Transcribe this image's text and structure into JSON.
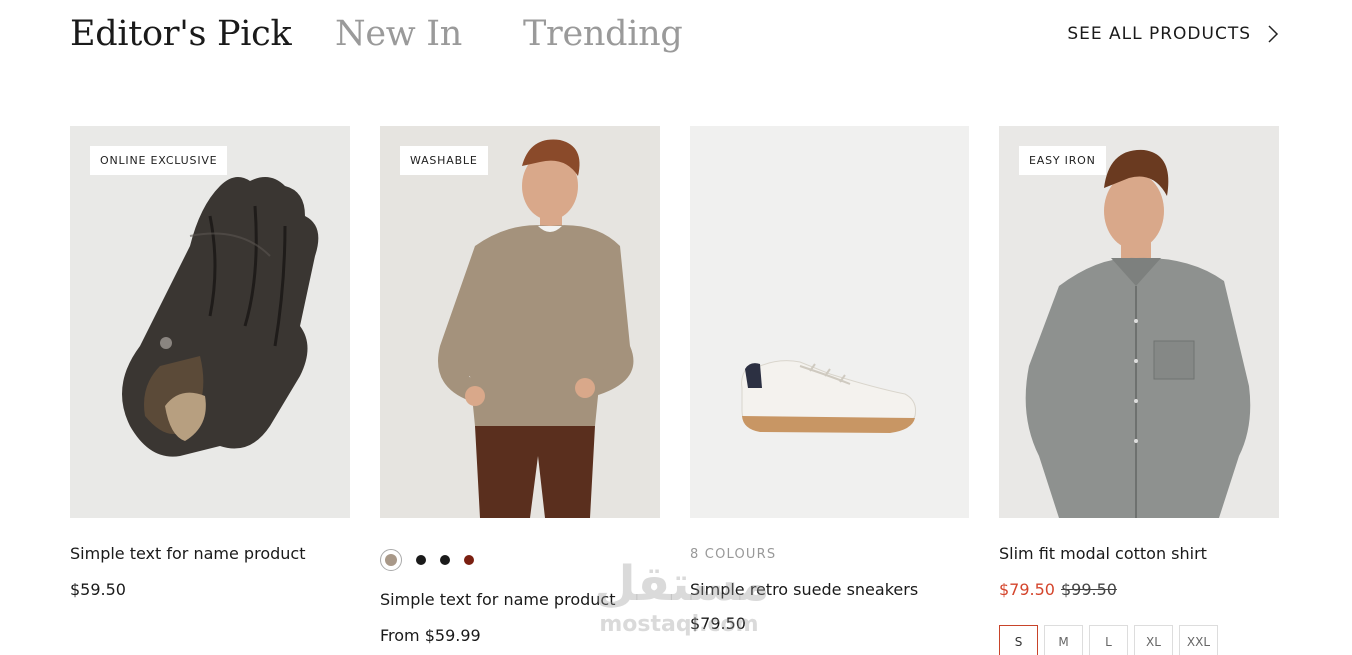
{
  "header": {
    "tabs": [
      {
        "label": "Editor's Pick",
        "active": true
      },
      {
        "label": "New In",
        "active": false
      },
      {
        "label": "Trending",
        "active": false
      }
    ],
    "see_all_label": "SEE ALL PRODUCTS"
  },
  "products": [
    {
      "badge": "ONLINE EXCLUSIVE",
      "name": "Simple text for name product",
      "price": "$59.50",
      "image_icon": "leather-glove"
    },
    {
      "badge": "WASHABLE",
      "name": "Simple text for name product",
      "price": "From $59.99",
      "image_icon": "sweater-model",
      "swatches": [
        "#a89888",
        "#1a1a1a",
        "#1a1a1a",
        "#7a1f10"
      ]
    },
    {
      "colours_label": "8 COLOURS",
      "name": "Simple retro suede sneakers",
      "price": "$79.50",
      "image_icon": "white-sneaker"
    },
    {
      "badge": "EASY IRON",
      "name": "Slim fit modal cotton shirt",
      "sale_price": "$79.50",
      "old_price": "$99.50",
      "image_icon": "shirt-model",
      "sizes": [
        "S",
        "M",
        "L",
        "XL",
        "XXL"
      ],
      "selected_size": "S"
    }
  ],
  "watermark": {
    "arabic": "مستقل",
    "latin": "mostaql.com"
  },
  "colors": {
    "sale": "#d4452c",
    "inactive_tab": "#9a9a9a",
    "text": "#1a1a1a"
  }
}
